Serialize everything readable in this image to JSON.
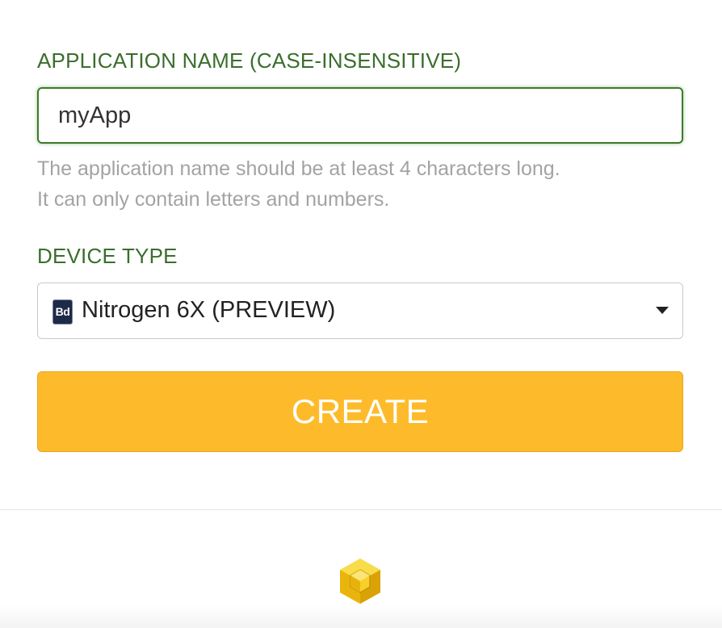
{
  "form": {
    "app_name": {
      "label": "APPLICATION NAME (CASE-INSENSITIVE)",
      "value": "myApp",
      "help_line_1": "The application name should be at least 4 characters long.",
      "help_line_2": "It can only contain letters and numbers."
    },
    "device_type": {
      "label": "DEVICE TYPE",
      "selected": "Nitrogen 6X (PREVIEW)",
      "icon_text": "Bd",
      "icon": "board-icon"
    },
    "create_button": {
      "label": "CREATE"
    }
  },
  "footer": {
    "logo_icon": "cube-logo-icon"
  },
  "colors": {
    "label_green": "#3a6e2c",
    "input_focus_border": "#3d7a2c",
    "help_text": "#a3a3a3",
    "button_yellow": "#fdbb2b",
    "button_text": "#ffffff",
    "logo_yellow": "#f5c518"
  }
}
